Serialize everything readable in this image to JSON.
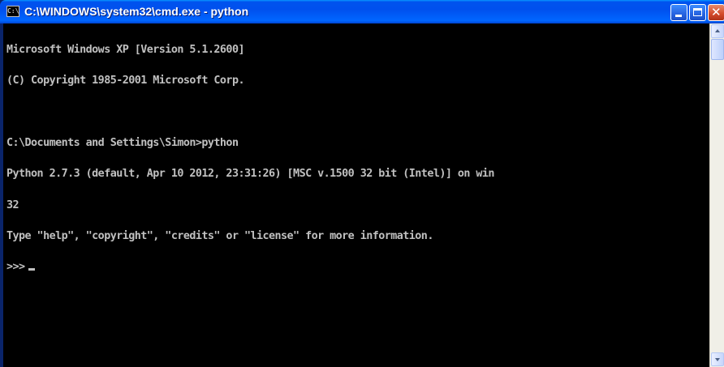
{
  "window": {
    "title": "C:\\WINDOWS\\system32\\cmd.exe - python",
    "icon": "cmd-icon",
    "buttons": {
      "minimize": "minimize-icon",
      "maximize": "maximize-icon",
      "close": "close-icon"
    }
  },
  "console": {
    "lines": [
      "Microsoft Windows XP [Version 5.1.2600]",
      "(C) Copyright 1985-2001 Microsoft Corp.",
      "",
      "C:\\Documents and Settings\\Simon>python",
      "Python 2.7.3 (default, Apr 10 2012, 23:31:26) [MSC v.1500 32 bit (Intel)] on win",
      "32",
      "Type \"help\", \"copyright\", \"credits\" or \"license\" for more information.",
      ">>>"
    ],
    "text_color": "#c0c0c0",
    "background_color": "#000000"
  }
}
